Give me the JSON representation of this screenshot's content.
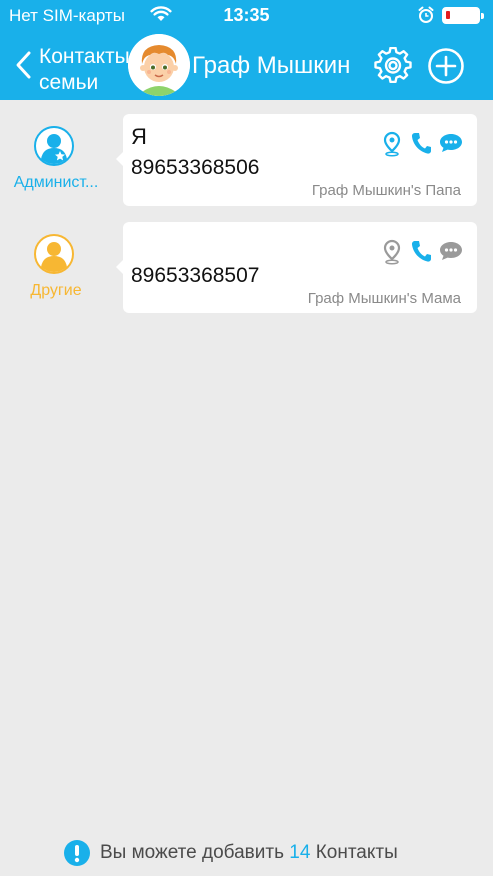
{
  "status_bar": {
    "carrier": "Нет SIM-карты",
    "time": "13:35"
  },
  "nav": {
    "back_label": "Контакты\nсемьи",
    "title": "Граф Мышкин"
  },
  "contacts": [
    {
      "role": "Администратор",
      "role_display": "Админист...",
      "role_color": "#19b0ea",
      "name": "Я",
      "phone": "89653368506",
      "relation": "Граф Мышкин's Папа"
    },
    {
      "role": "Другие",
      "role_display": "Другие",
      "role_color": "#f7b733",
      "name": "",
      "phone": "89653368507",
      "relation": "Граф Мышкин's Мама"
    }
  ],
  "footer": {
    "prefix": "Вы можете добавить",
    "count": "14",
    "suffix": "Контакты"
  },
  "colors": {
    "accent": "#19b0ea",
    "background": "#ebebeb",
    "other_role": "#f7b733",
    "inactive_icon": "#9a9a9a"
  },
  "icons": {
    "status": [
      "wifi-icon",
      "alarm-icon",
      "battery-icon"
    ],
    "nav": [
      "back-chevron-icon",
      "child-avatar",
      "settings-gear-icon",
      "add-circle-icon"
    ],
    "contact_actions": [
      "location-pin-icon",
      "phone-icon",
      "chat-bubble-icon"
    ],
    "footer": [
      "info-icon"
    ]
  }
}
